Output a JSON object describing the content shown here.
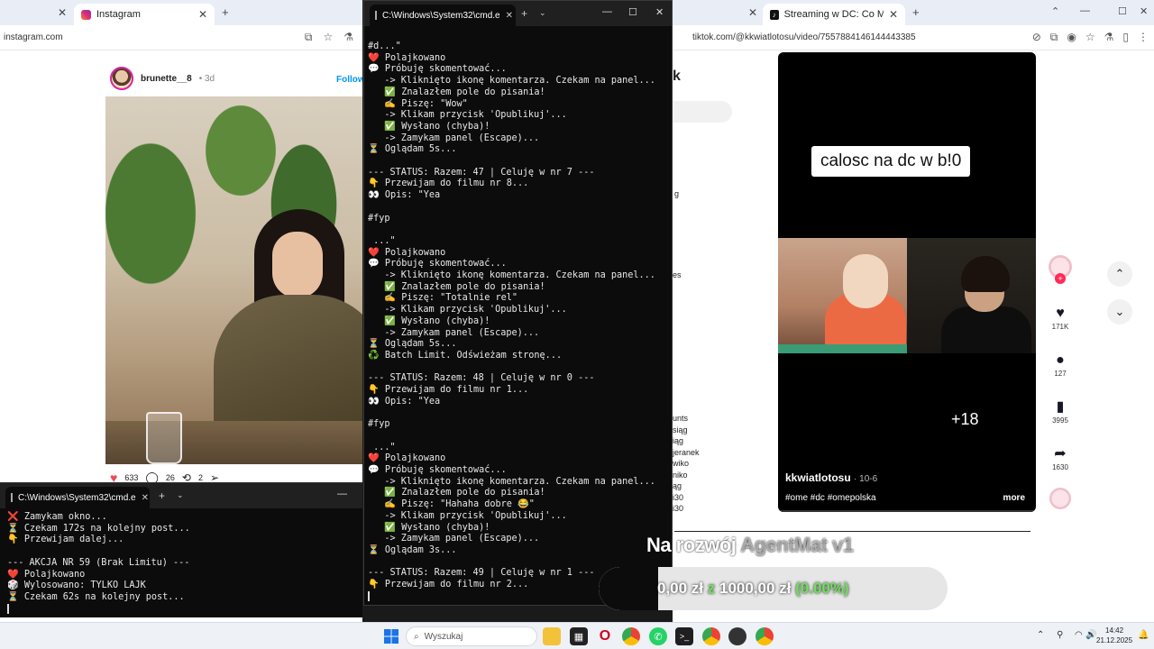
{
  "left_browser": {
    "tab_title": "Instagram",
    "url": "instagram.com",
    "post": {
      "username": "brunette__8",
      "time": "3d",
      "follow_label": "Follow",
      "likes": "633",
      "comments": "26",
      "shares": "2"
    }
  },
  "cmd_small": {
    "tab_title": "C:\\Windows\\System32\\cmd.e",
    "lines": [
      "❌ Zamykam okno...",
      "⏳ Czekam 172s na kolejny post...",
      "👇 Przewijam dalej...",
      "",
      "--- AKCJA NR 59 (Brak Limitu) ---",
      "❤️ Polajkowano",
      "🎲 Wylosowano: TYLKO LAJK",
      "⏳ Czekam 62s na kolejny post..."
    ]
  },
  "cmd_big": {
    "tab_title": "C:\\Windows\\System32\\cmd.e",
    "lines": [
      "#d...\"",
      "❤️ Polajkowano",
      "💬 Próbuję skomentować...",
      "   -> Kliknięto ikonę komentarza. Czekam na panel...",
      "   ✅ Znalazłem pole do pisania!",
      "   ✍️ Piszę: \"Wow\"",
      "   -> Klikam przycisk 'Opublikuj'...",
      "   ✅ Wysłano (chyba)!",
      "   -> Zamykam panel (Escape)...",
      "⏳ Oglądam 5s...",
      "",
      "--- STATUS: Razem: 47 | Celuję w nr 7 ---",
      "👇 Przewijam do filmu nr 8...",
      "👀 Opis: \"Yea",
      "",
      "#fyp",
      "",
      " ...\"",
      "❤️ Polajkowano",
      "💬 Próbuję skomentować...",
      "   -> Kliknięto ikonę komentarza. Czekam na panel...",
      "   ✅ Znalazłem pole do pisania!",
      "   ✍️ Piszę: \"Totalnie rel\"",
      "   -> Klikam przycisk 'Opublikuj'...",
      "   ✅ Wysłano (chyba)!",
      "   -> Zamykam panel (Escape)...",
      "⏳ Oglądam 5s...",
      "♻️ Batch Limit. Odświeżam stronę...",
      "",
      "--- STATUS: Razem: 48 | Celuję w nr 0 ---",
      "👇 Przewijam do filmu nr 1...",
      "👀 Opis: \"Yea",
      "",
      "#fyp",
      "",
      " ...\"",
      "❤️ Polajkowano",
      "💬 Próbuję skomentować...",
      "   -> Kliknięto ikonę komentarza. Czekam na panel...",
      "   ✅ Znalazłem pole do pisania!",
      "   ✍️ Piszę: \"Hahaha dobre 😂\"",
      "   -> Klikam przycisk 'Opublikuj'...",
      "   ✅ Wysłano (chyba)!",
      "   -> Zamykam panel (Escape)...",
      "⏳ Oglądam 3s...",
      "",
      "--- STATUS: Razem: 49 | Celuję w nr 1 ---",
      "👇 Przewijam do filmu nr 2..."
    ]
  },
  "right_browser": {
    "tab_title": "Streaming w DC: Co Musi",
    "url": "tiktok.com/@kkwiatlotosu/video/7557884146144443385",
    "left_strip": {
      "heading": "k",
      "snippet_g": "g",
      "snippet_es": "es",
      "list": [
        "unts",
        "siąg",
        "iąg",
        "jeranek",
        "wiko",
        "niko",
        "ąg",
        "i30",
        "i30"
      ]
    },
    "video": {
      "caption": "calosc na dc w b!0",
      "badge": "+18",
      "author": "kkwiatlotosu",
      "date": "10-6",
      "tags": "#ome #dc #omepolska",
      "more_label": "more"
    },
    "side": {
      "likes": "171K",
      "comments": "127",
      "saves": "3995",
      "shares": "1630"
    }
  },
  "overlay": {
    "title_bright": "Na rozwój ",
    "title_dim": "AgentMat v1",
    "progress_current": "0,00 zł",
    "progress_sep": " z ",
    "progress_goal": "1000,00 zł",
    "progress_percent": "(0.00%)",
    "progress_fraction": 0.0
  },
  "taskbar": {
    "search_placeholder": "Wyszukaj",
    "time": "14:42",
    "date": "21.12.2025"
  }
}
